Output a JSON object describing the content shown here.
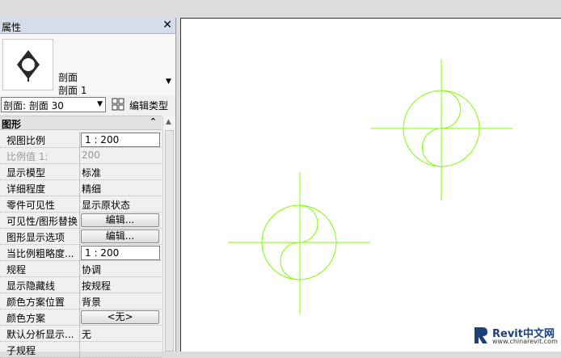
{
  "properties_panel": {
    "title": "属性",
    "close_glyph": "✕",
    "type_selector": {
      "family": "剖面",
      "type": "剖面 1",
      "arrow": "▼"
    },
    "instance_selector": "剖面: 剖面 30",
    "edit_type_label": "编辑类型",
    "section": {
      "label": "图形",
      "collapse_glyph": "⌃"
    },
    "rows": [
      {
        "name": "视图比例",
        "value": "1 : 200"
      },
      {
        "name": "比例值 1:",
        "value": "200"
      },
      {
        "name": "显示模型",
        "value": "标准"
      },
      {
        "name": "详细程度",
        "value": "精细"
      },
      {
        "name": "零件可见性",
        "value": "显示原状态"
      },
      {
        "name": "可见性/图形替换",
        "value": "编辑..."
      },
      {
        "name": "图形显示选项",
        "value": "编辑..."
      },
      {
        "name": "当比例粗略度...",
        "value": "1 : 200"
      },
      {
        "name": "规程",
        "value": "协调"
      },
      {
        "name": "显示隐藏线",
        "value": "按规程"
      },
      {
        "name": "颜色方案位置",
        "value": "背景"
      },
      {
        "name": "颜色方案",
        "value": "<无>"
      },
      {
        "name": "默认分析显示...",
        "value": "无"
      },
      {
        "name": "子规程",
        "value": ""
      }
    ]
  },
  "watermark": {
    "brand": "Revit中文网",
    "url": "www.chinarevit.com"
  },
  "colors": {
    "symbol_line": "#80ff00",
    "panel_bg": "#f0f0f0",
    "title_bg": "#d4dde9"
  }
}
